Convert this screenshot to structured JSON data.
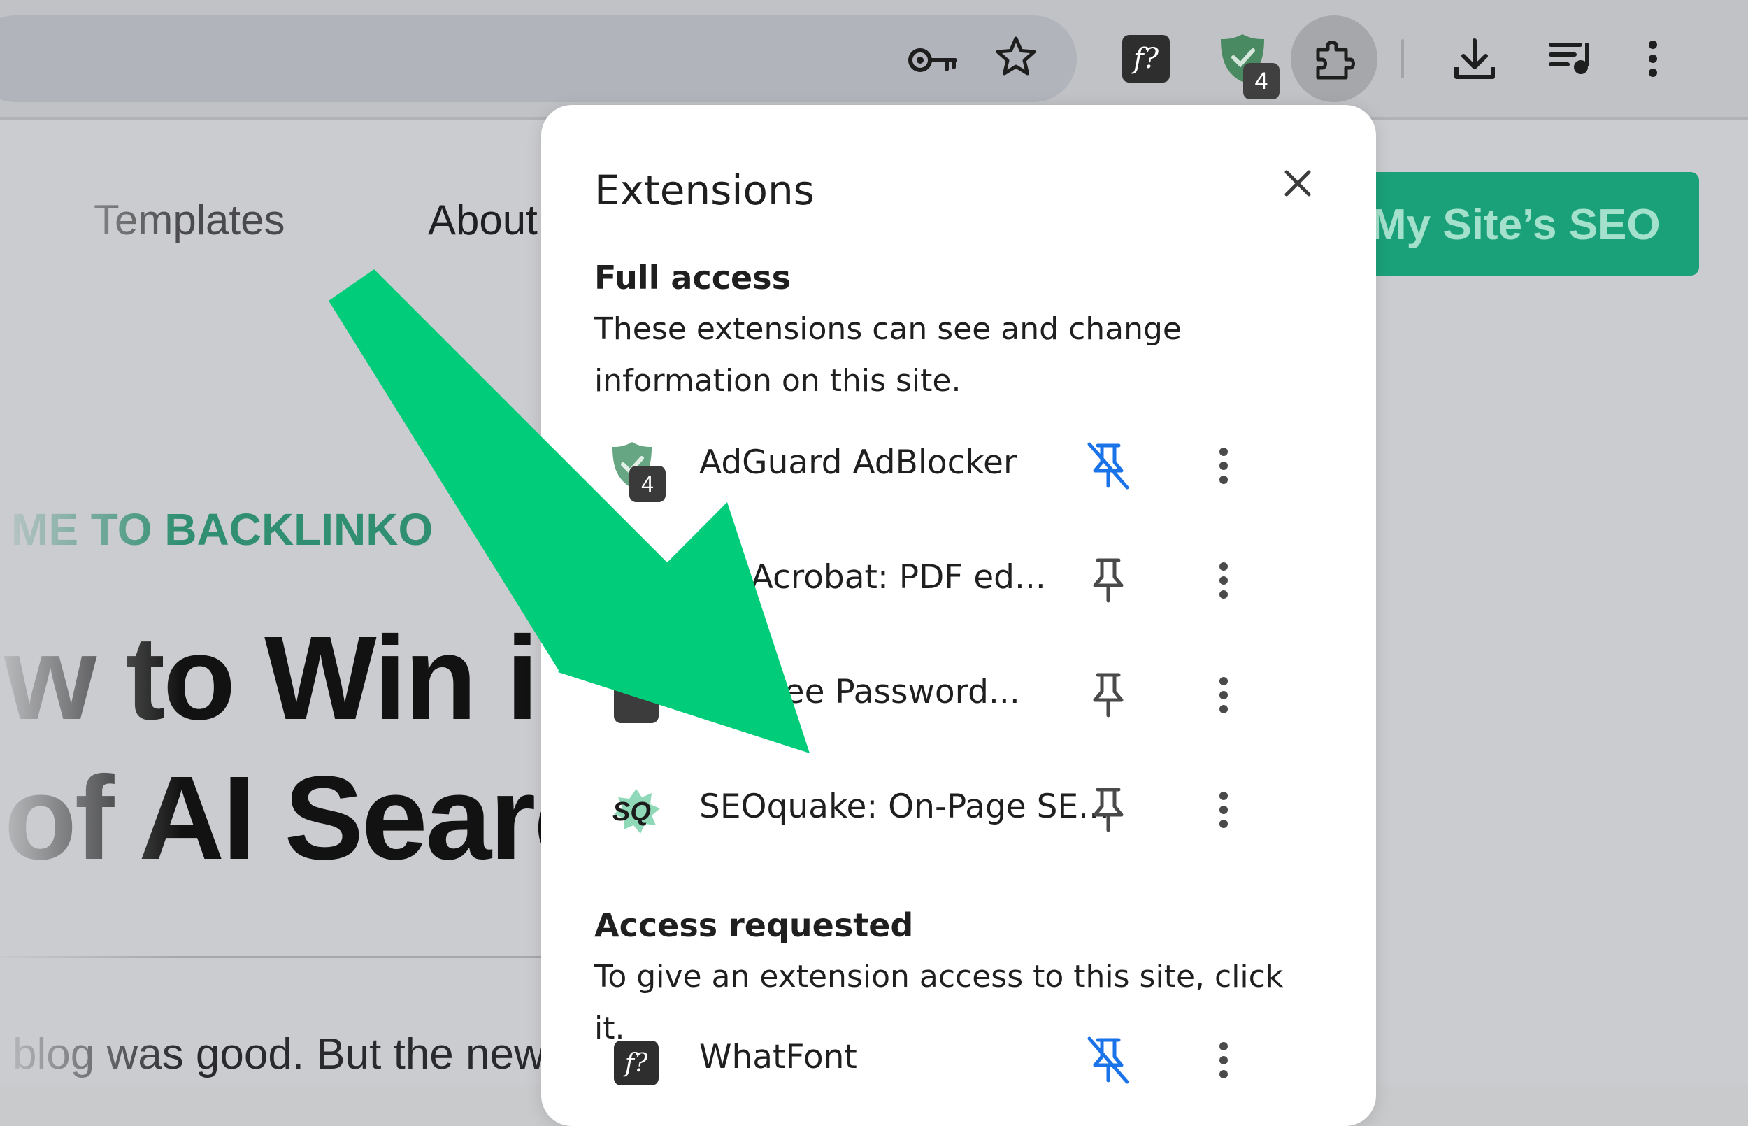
{
  "toolbar": {
    "icons": {
      "key": "key-icon",
      "star": "star-icon",
      "whatfont": "whatfont-extension-icon",
      "adguard": "adguard-extension-icon",
      "extensions": "puzzle-piece-icon",
      "downloads": "download-icon",
      "media": "media-queue-icon",
      "menu": "vertical-dots-icon"
    },
    "whatfont_label": "f?",
    "adguard_badge": "4"
  },
  "page": {
    "nav": {
      "templates": "Templates",
      "about": "About"
    },
    "cta_label": "My Site’s SEO",
    "eyebrow": "ME TO BACKLINKO",
    "headline_line1": "w to Win in",
    "headline_line2": "of AI Searc",
    "body": "blog was good. But the new"
  },
  "popup": {
    "title": "Extensions",
    "full_access": {
      "heading": "Full access",
      "description": "These extensions can see and change information on this site."
    },
    "extensions": [
      {
        "name": "AdGuard AdBlocker",
        "icon": "adguard-icon",
        "badge": "4",
        "pinned": true
      },
      {
        "name": "be Acrobat: PDF ed...",
        "icon": "acrobat-icon",
        "pinned": false
      },
      {
        "name": "ss: Free Password...",
        "icon": "password-manager-icon",
        "pinned": false
      },
      {
        "name": "SEOquake: On-Page SE...",
        "icon": "seoquake-icon",
        "icon_text": "SQ",
        "pinned": false
      }
    ],
    "access_requested": {
      "heading": "Access requested",
      "description": "To give an extension access to this site, click it."
    },
    "requested_extensions": [
      {
        "name": "WhatFont",
        "icon": "whatfont-icon",
        "icon_text": "f?",
        "pinned": true
      }
    ]
  },
  "colors": {
    "arrow": "#00cc7a",
    "pin_active": "#1a73e8",
    "cta": "#1ba17a",
    "eyebrow": "#2f8f70"
  }
}
